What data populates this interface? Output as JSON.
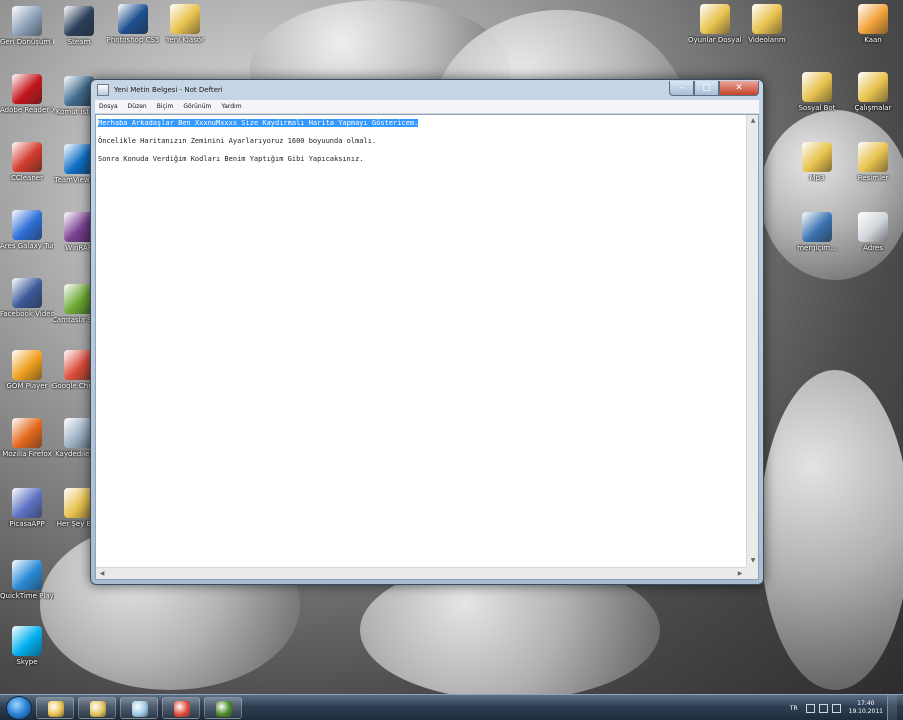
{
  "desktop": {
    "left_icons": [
      {
        "label": "Geri Dönüşüm Kutusu",
        "icon": "recycle-bin-icon",
        "color": "#8aa0b8"
      },
      {
        "label": "Adobe Reader X",
        "icon": "adobe-reader-icon",
        "color": "#c4161c"
      },
      {
        "label": "CCleaner",
        "icon": "ccleaner-icon",
        "color": "#d13b2b"
      },
      {
        "label": "Ares Galaxy Turbo",
        "icon": "ares-icon",
        "color": "#2c6fd6"
      },
      {
        "label": "Facebook Video Ca...",
        "icon": "facebook-icon",
        "color": "#3b5998"
      },
      {
        "label": "GOM Player",
        "icon": "gom-player-icon",
        "color": "#f0a020"
      },
      {
        "label": "Mozilla Firefox",
        "icon": "firefox-icon",
        "color": "#e4671b"
      },
      {
        "label": "PicasaAPP",
        "icon": "picasa-icon",
        "color": "#5d72c4"
      },
      {
        "label": "QuickTime Player",
        "icon": "quicktime-icon",
        "color": "#2a8ad6"
      },
      {
        "label": "Skype",
        "icon": "skype-icon",
        "color": "#00aff0"
      }
    ],
    "second_column_icons": [
      {
        "label": "Steam",
        "icon": "steam-icon",
        "color": "#2a3f5a"
      },
      {
        "label": "Komut İstemi",
        "icon": "app-icon",
        "color": "#3e6b8e"
      },
      {
        "label": "TeamViewer 6",
        "icon": "teamviewer-icon",
        "color": "#0e6fc7"
      },
      {
        "label": "WinRAR",
        "icon": "winrar-icon",
        "color": "#7a3f91"
      },
      {
        "label": "Camtasia Studio",
        "icon": "camtasia-icon",
        "color": "#6aa832"
      },
      {
        "label": "Google Chrome",
        "icon": "chrome-icon",
        "color": "#dd4b39"
      },
      {
        "label": "Kaydedilenler",
        "icon": "app-icon",
        "color": "#9bb0c4"
      },
      {
        "label": "Her Şey Ekle",
        "icon": "folder-icon",
        "color": "#e8c24e"
      }
    ],
    "top_icons": [
      {
        "label": "Photoshop CS5",
        "icon": "photoshop-icon",
        "color": "#1c4f8f"
      },
      {
        "label": "Yeni Klasör",
        "icon": "folder-icon",
        "color": "#e8c24e"
      }
    ],
    "right_icons": [
      {
        "label": "Oyunlar Dosyaları",
        "icon": "folder-icon",
        "color": "#e8c24e"
      },
      {
        "label": "Videolarım",
        "icon": "folder-icon",
        "color": "#e8c24e"
      },
      {
        "label": "Kaan",
        "icon": "user-folder-icon",
        "color": "#f2a23a"
      },
      {
        "label": "Sosyal Bot",
        "icon": "folder-icon",
        "color": "#e8c24e"
      },
      {
        "label": "Çalışmalar",
        "icon": "folder-icon",
        "color": "#e8c24e"
      },
      {
        "label": "Mp3",
        "icon": "folder-icon",
        "color": "#e8c24e"
      },
      {
        "label": "Resimler",
        "icon": "folder-icon",
        "color": "#e8c24e"
      },
      {
        "label": "mergiçim...",
        "icon": "python-icon",
        "color": "#3a72b0"
      },
      {
        "label": "Adres",
        "icon": "app-icon",
        "color": "#cfd4da"
      }
    ]
  },
  "notepad": {
    "title": "Yeni Metin Belgesi - Not Defteri",
    "controls": {
      "minimize": "–",
      "maximize": "□",
      "close": "✕"
    },
    "menu": [
      "Dosya",
      "Düzen",
      "Biçim",
      "Görünüm",
      "Yardım"
    ],
    "lines": [
      {
        "text": "Merhaba Arkadaşlar Ben XxxnuMxxxx Size Kaydırmalı Harita Yapmayı Göstericem.",
        "selected": true
      },
      {
        "text": "Öncelikle Haritanızın Zeminini Ayarlarıyoruz 1600 boyuunda olmalı.",
        "selected": false
      },
      {
        "text": "Sonra Konuda Verdiğim Kodları Benim Yaptığım Gibi Yapıcaksınız.",
        "selected": false
      }
    ]
  },
  "taskbar": {
    "buttons": [
      {
        "name": "explorer",
        "icon": "explorer-icon",
        "color": "#e8c24e"
      },
      {
        "name": "winamp",
        "icon": "winamp-icon",
        "color": "#e2c25a"
      },
      {
        "name": "notepad",
        "icon": "notepad-icon",
        "color": "#9fc7e8"
      },
      {
        "name": "chrome",
        "icon": "chrome-icon",
        "color": "#dd4b39"
      },
      {
        "name": "camtasia",
        "icon": "camtasia-icon",
        "color": "#4a8a2a"
      }
    ],
    "language": "TR",
    "time": "17:40",
    "date": "19.10.2011"
  }
}
